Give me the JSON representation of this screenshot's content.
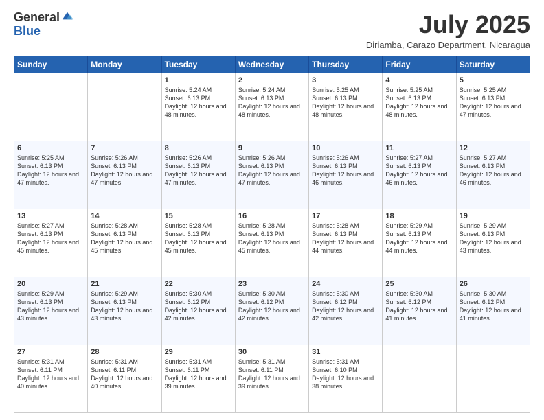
{
  "header": {
    "logo_general": "General",
    "logo_blue": "Blue",
    "month_title": "July 2025",
    "subtitle": "Diriamba, Carazo Department, Nicaragua"
  },
  "days_of_week": [
    "Sunday",
    "Monday",
    "Tuesday",
    "Wednesday",
    "Thursday",
    "Friday",
    "Saturday"
  ],
  "weeks": [
    [
      {
        "day": "",
        "info": ""
      },
      {
        "day": "",
        "info": ""
      },
      {
        "day": "1",
        "info": "Sunrise: 5:24 AM\nSunset: 6:13 PM\nDaylight: 12 hours and 48 minutes."
      },
      {
        "day": "2",
        "info": "Sunrise: 5:24 AM\nSunset: 6:13 PM\nDaylight: 12 hours and 48 minutes."
      },
      {
        "day": "3",
        "info": "Sunrise: 5:25 AM\nSunset: 6:13 PM\nDaylight: 12 hours and 48 minutes."
      },
      {
        "day": "4",
        "info": "Sunrise: 5:25 AM\nSunset: 6:13 PM\nDaylight: 12 hours and 48 minutes."
      },
      {
        "day": "5",
        "info": "Sunrise: 5:25 AM\nSunset: 6:13 PM\nDaylight: 12 hours and 47 minutes."
      }
    ],
    [
      {
        "day": "6",
        "info": "Sunrise: 5:25 AM\nSunset: 6:13 PM\nDaylight: 12 hours and 47 minutes."
      },
      {
        "day": "7",
        "info": "Sunrise: 5:26 AM\nSunset: 6:13 PM\nDaylight: 12 hours and 47 minutes."
      },
      {
        "day": "8",
        "info": "Sunrise: 5:26 AM\nSunset: 6:13 PM\nDaylight: 12 hours and 47 minutes."
      },
      {
        "day": "9",
        "info": "Sunrise: 5:26 AM\nSunset: 6:13 PM\nDaylight: 12 hours and 47 minutes."
      },
      {
        "day": "10",
        "info": "Sunrise: 5:26 AM\nSunset: 6:13 PM\nDaylight: 12 hours and 46 minutes."
      },
      {
        "day": "11",
        "info": "Sunrise: 5:27 AM\nSunset: 6:13 PM\nDaylight: 12 hours and 46 minutes."
      },
      {
        "day": "12",
        "info": "Sunrise: 5:27 AM\nSunset: 6:13 PM\nDaylight: 12 hours and 46 minutes."
      }
    ],
    [
      {
        "day": "13",
        "info": "Sunrise: 5:27 AM\nSunset: 6:13 PM\nDaylight: 12 hours and 45 minutes."
      },
      {
        "day": "14",
        "info": "Sunrise: 5:28 AM\nSunset: 6:13 PM\nDaylight: 12 hours and 45 minutes."
      },
      {
        "day": "15",
        "info": "Sunrise: 5:28 AM\nSunset: 6:13 PM\nDaylight: 12 hours and 45 minutes."
      },
      {
        "day": "16",
        "info": "Sunrise: 5:28 AM\nSunset: 6:13 PM\nDaylight: 12 hours and 45 minutes."
      },
      {
        "day": "17",
        "info": "Sunrise: 5:28 AM\nSunset: 6:13 PM\nDaylight: 12 hours and 44 minutes."
      },
      {
        "day": "18",
        "info": "Sunrise: 5:29 AM\nSunset: 6:13 PM\nDaylight: 12 hours and 44 minutes."
      },
      {
        "day": "19",
        "info": "Sunrise: 5:29 AM\nSunset: 6:13 PM\nDaylight: 12 hours and 43 minutes."
      }
    ],
    [
      {
        "day": "20",
        "info": "Sunrise: 5:29 AM\nSunset: 6:13 PM\nDaylight: 12 hours and 43 minutes."
      },
      {
        "day": "21",
        "info": "Sunrise: 5:29 AM\nSunset: 6:13 PM\nDaylight: 12 hours and 43 minutes."
      },
      {
        "day": "22",
        "info": "Sunrise: 5:30 AM\nSunset: 6:12 PM\nDaylight: 12 hours and 42 minutes."
      },
      {
        "day": "23",
        "info": "Sunrise: 5:30 AM\nSunset: 6:12 PM\nDaylight: 12 hours and 42 minutes."
      },
      {
        "day": "24",
        "info": "Sunrise: 5:30 AM\nSunset: 6:12 PM\nDaylight: 12 hours and 42 minutes."
      },
      {
        "day": "25",
        "info": "Sunrise: 5:30 AM\nSunset: 6:12 PM\nDaylight: 12 hours and 41 minutes."
      },
      {
        "day": "26",
        "info": "Sunrise: 5:30 AM\nSunset: 6:12 PM\nDaylight: 12 hours and 41 minutes."
      }
    ],
    [
      {
        "day": "27",
        "info": "Sunrise: 5:31 AM\nSunset: 6:11 PM\nDaylight: 12 hours and 40 minutes."
      },
      {
        "day": "28",
        "info": "Sunrise: 5:31 AM\nSunset: 6:11 PM\nDaylight: 12 hours and 40 minutes."
      },
      {
        "day": "29",
        "info": "Sunrise: 5:31 AM\nSunset: 6:11 PM\nDaylight: 12 hours and 39 minutes."
      },
      {
        "day": "30",
        "info": "Sunrise: 5:31 AM\nSunset: 6:11 PM\nDaylight: 12 hours and 39 minutes."
      },
      {
        "day": "31",
        "info": "Sunrise: 5:31 AM\nSunset: 6:10 PM\nDaylight: 12 hours and 38 minutes."
      },
      {
        "day": "",
        "info": ""
      },
      {
        "day": "",
        "info": ""
      }
    ]
  ]
}
